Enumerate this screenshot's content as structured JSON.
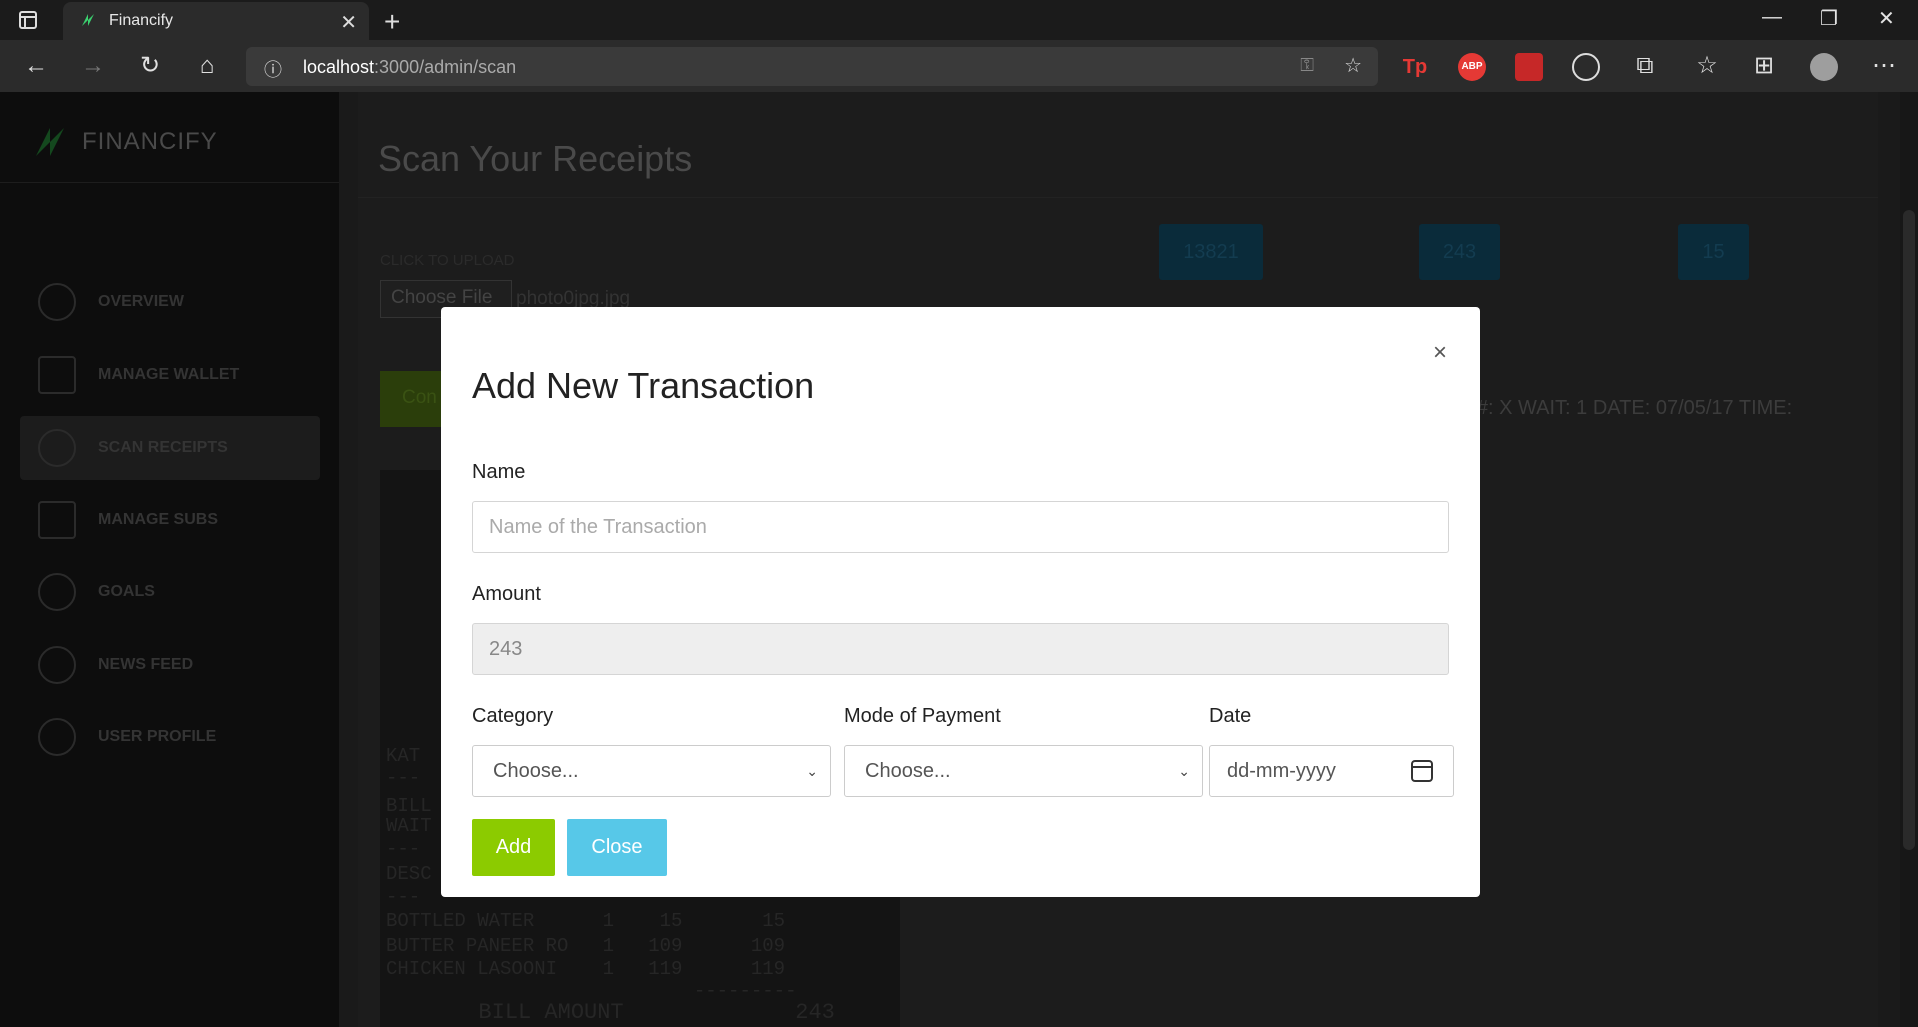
{
  "browser": {
    "tab_title": "Financify",
    "url_host": "localhost",
    "url_path": ":3000/admin/scan",
    "ext_tp": "Tp",
    "ext_abp": "ABP"
  },
  "sidebar": {
    "brand": "FINANCIFY",
    "items": [
      {
        "label": "OVERVIEW"
      },
      {
        "label": "MANAGE WALLET"
      },
      {
        "label": "SCAN RECEIPTS"
      },
      {
        "label": "MANAGE SUBS"
      },
      {
        "label": "GOALS"
      },
      {
        "label": "NEWS FEED"
      },
      {
        "label": "USER PROFILE"
      }
    ]
  },
  "main": {
    "title": "Scan Your Receipts",
    "upload_label": "CLICK TO UPLOAD",
    "choose_file": "Choose File",
    "file_name": "photo0jpg.jpg",
    "badges": [
      "13821",
      "243",
      "15"
    ],
    "confirm_label": "Con",
    "ocr_text": "E #: X WAIT: 1 DATE: 07/05/17 TIME:",
    "receipt_lines": [
      "KAT",
      "---",
      "BILL",
      "WAIT",
      "---",
      "DESC",
      "---",
      "BOTTLED WATER      1    15       15",
      "BUTTER PANEER RO   1   109      109",
      "CHICKEN LASOONI    1   119      119",
      "                           ---------",
      "       BILL AMOUNT             243"
    ]
  },
  "modal": {
    "title": "Add New Transaction",
    "close_symbol": "×",
    "name_label": "Name",
    "name_placeholder": "Name of the Transaction",
    "amount_label": "Amount",
    "amount_value": "243",
    "category_label": "Category",
    "category_value": "Choose...",
    "payment_label": "Mode of Payment",
    "payment_value": "Choose...",
    "date_label": "Date",
    "date_placeholder": "dd-mm-yyyy",
    "add_label": "Add",
    "close_label": "Close"
  },
  "colors": {
    "accent_green": "#8ccb00",
    "accent_cyan": "#57c8e8"
  }
}
